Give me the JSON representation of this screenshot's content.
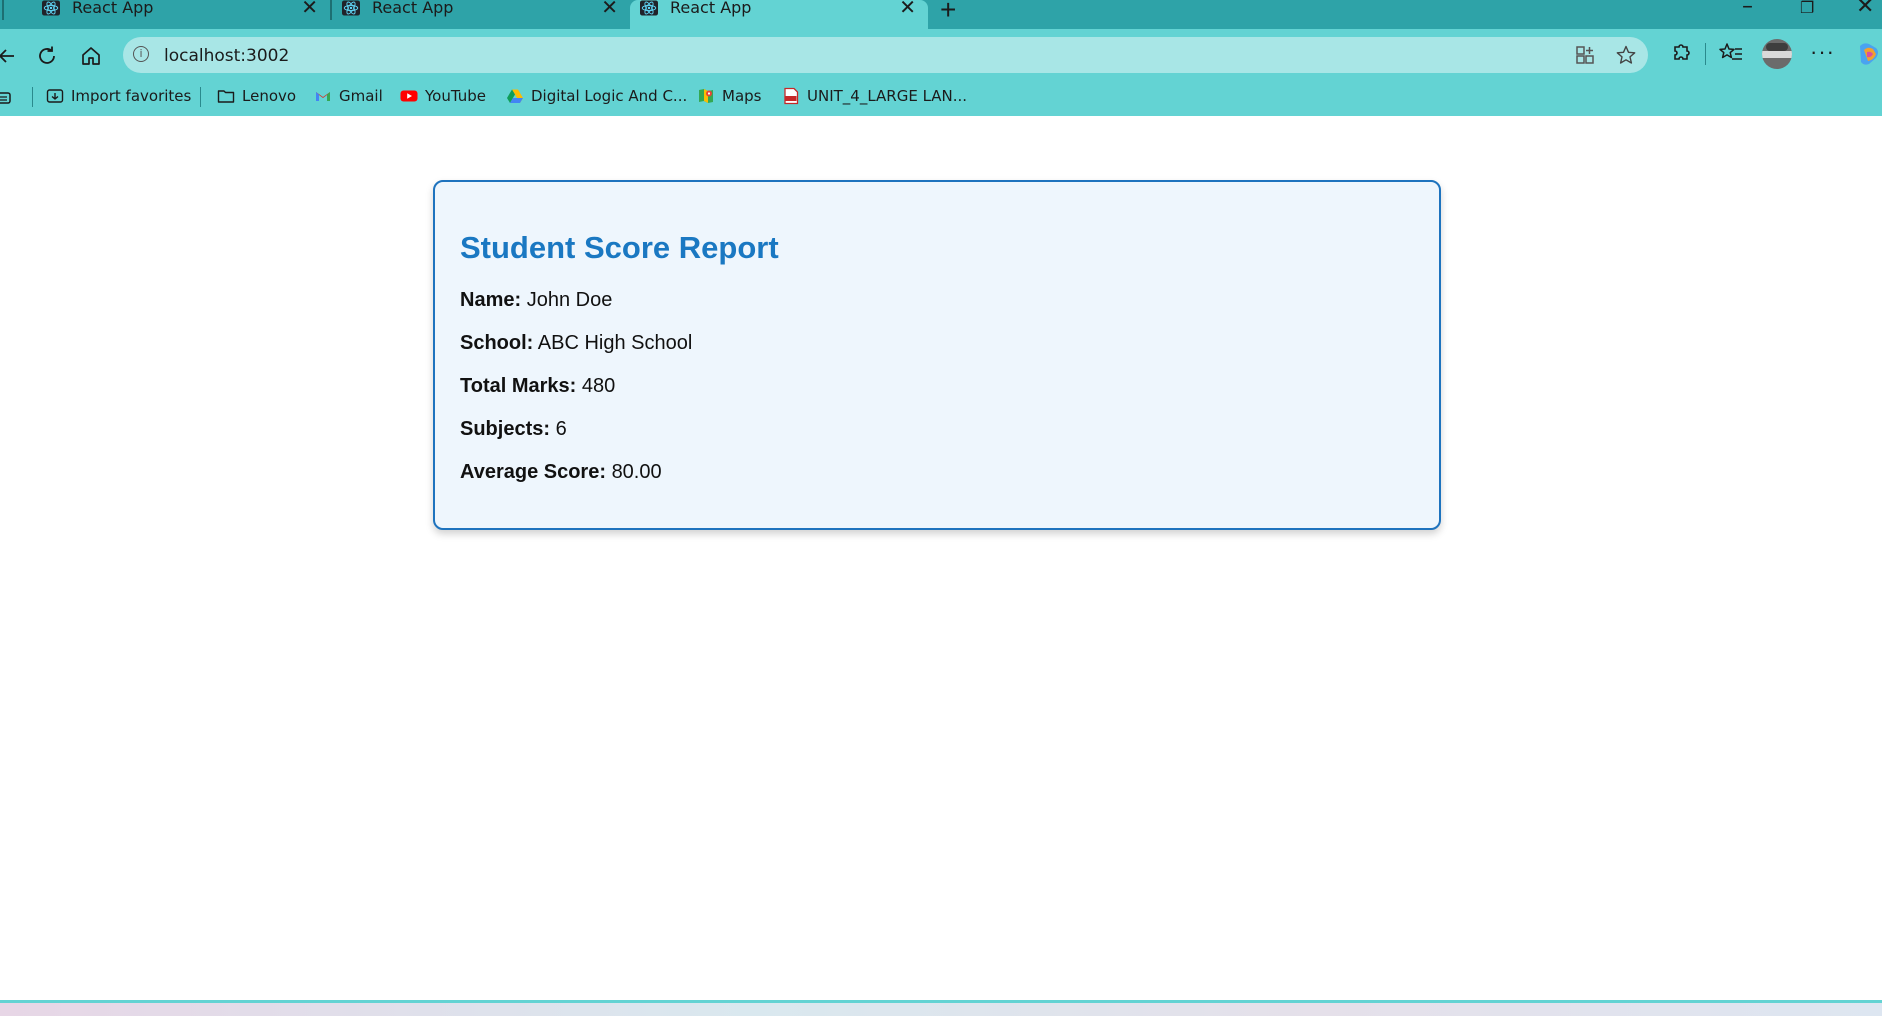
{
  "browser": {
    "tabs": [
      {
        "title": "React App",
        "active": false
      },
      {
        "title": "React App",
        "active": false
      },
      {
        "title": "React App",
        "active": true
      }
    ],
    "address": {
      "url": "localhost:3002"
    },
    "bookmarks": [
      {
        "label": "Import favorites",
        "icon": "import-icon"
      },
      {
        "label": "Lenovo",
        "icon": "folder-icon"
      },
      {
        "label": "Gmail",
        "icon": "gmail-icon"
      },
      {
        "label": "YouTube",
        "icon": "youtube-icon"
      },
      {
        "label": "Digital Logic And C...",
        "icon": "drive-icon"
      },
      {
        "label": "Maps",
        "icon": "maps-icon"
      },
      {
        "label": "UNIT_4_LARGE LAN...",
        "icon": "pdf-icon"
      }
    ],
    "colors": {
      "chrome": "#63d3d3",
      "tabstrip": "#2ea3a8"
    }
  },
  "report": {
    "title": "Student Score Report",
    "fields": [
      {
        "label": "Name:",
        "value": "John Doe"
      },
      {
        "label": "School:",
        "value": "ABC High School"
      },
      {
        "label": "Total Marks:",
        "value": "480"
      },
      {
        "label": "Subjects:",
        "value": "6"
      },
      {
        "label": "Average Score:",
        "value": "80.00"
      }
    ],
    "colors": {
      "title": "#1a78c2",
      "border": "#1e73be",
      "background": "#eef6fd"
    }
  }
}
